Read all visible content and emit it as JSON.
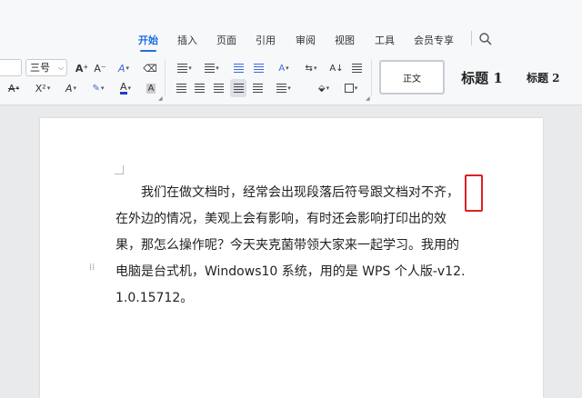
{
  "ribbon": {
    "tabs": [
      {
        "label": "开始",
        "active": true
      },
      {
        "label": "插入"
      },
      {
        "label": "页面"
      },
      {
        "label": "引用"
      },
      {
        "label": "审阅"
      },
      {
        "label": "视图"
      },
      {
        "label": "工具"
      },
      {
        "label": "会员专享"
      }
    ],
    "font_size": "三号",
    "tools_row1": {
      "grow_font": "A⁺",
      "shrink_font": "A⁻",
      "text_effect": "A",
      "clear_format": "⌫"
    },
    "tools_row2": {
      "strikethrough": "A",
      "superscript": "X²",
      "font_color": "A",
      "char_shading": "A"
    },
    "styles": {
      "normal": "正文",
      "heading1": "标题 1",
      "heading2": "标题 2"
    }
  },
  "document": {
    "paragraph": "我们在做文档时，经常会出现段落后符号跟文档对不齐，在外边的情况，美观上会有影响，有时还会影响打印出的效果，那怎么操作呢？今天夹克菌带领大家来一起学习。我用的电脑是台式机，Windows10 系统，用的是 WPS 个人版-v12.1.0.15712。"
  },
  "colors": {
    "accent": "#1f6fe5",
    "highlight": "#e02020",
    "font_color_bar": "#1f3fbf"
  }
}
